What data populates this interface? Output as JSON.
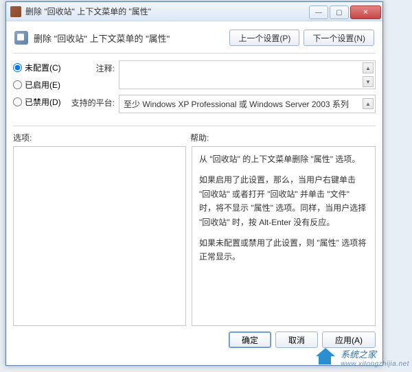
{
  "titlebar": {
    "title": "删除 \"回收站\" 上下文菜单的 \"属性\""
  },
  "header": {
    "title": "删除 \"回收站\" 上下文菜单的 \"属性\"",
    "prev_btn": "上一个设置(P)",
    "next_btn": "下一个设置(N)"
  },
  "radios": {
    "not_configured": "未配置(C)",
    "enabled": "已启用(E)",
    "disabled": "已禁用(D)"
  },
  "fields": {
    "comment_label": "注释:",
    "comment_value": "",
    "platform_label": "支持的平台:",
    "platform_value": "至少 Windows XP Professional 或 Windows Server 2003 系列"
  },
  "lower": {
    "options_label": "选项:",
    "help_label": "帮助:"
  },
  "help": {
    "p1": "从 \"回收站\" 的上下文菜单删除 \"属性\" 选项。",
    "p2": "如果启用了此设置，那么，当用户右键单击 \"回收站\" 或者打开 \"回收站\" 并单击 \"文件\" 时，将不显示 \"属性\" 选项。同样，当用户选择 \"回收站\" 时，按 Alt-Enter 没有反应。",
    "p3": "如果未配置或禁用了此设置，则 \"属性\" 选项将正常显示。"
  },
  "buttons": {
    "ok": "确定",
    "cancel": "取消",
    "apply": "应用(A)"
  },
  "watermark": {
    "name": "系统之家",
    "url": "www.xitongzhijia.net"
  }
}
